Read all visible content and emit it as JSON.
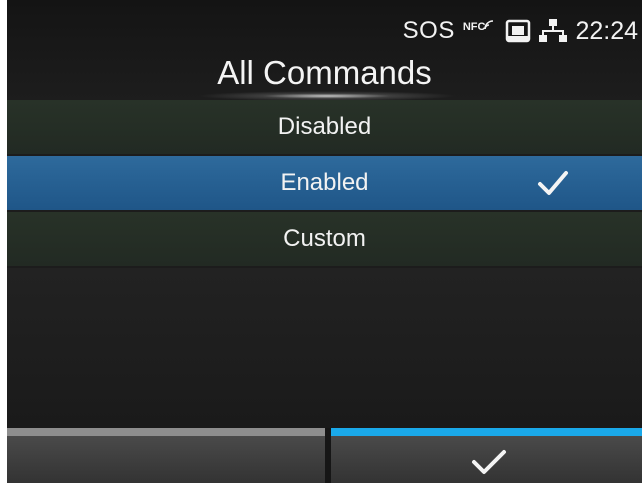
{
  "status_bar": {
    "sos_label": "SOS",
    "nfc_label": "NFC",
    "nfc_icon": "nfc-icon",
    "card_icon": "memory-card-icon",
    "network_icon": "wired-network-icon",
    "time": "22:24"
  },
  "header": {
    "title": "All Commands"
  },
  "options": [
    {
      "label": "Disabled",
      "selected": false
    },
    {
      "label": "Enabled",
      "selected": true,
      "checkmark_icon": "checkmark-icon"
    },
    {
      "label": "Custom",
      "selected": false
    }
  ],
  "footer": {
    "left_button_icon": "none",
    "right_button_icon": "checkmark-icon"
  },
  "colors": {
    "selected_row": "#1f5a8c",
    "confirm_accent": "#1aa9ea",
    "cancel_accent": "#8e8e8e",
    "background": "#1c1c1c"
  }
}
